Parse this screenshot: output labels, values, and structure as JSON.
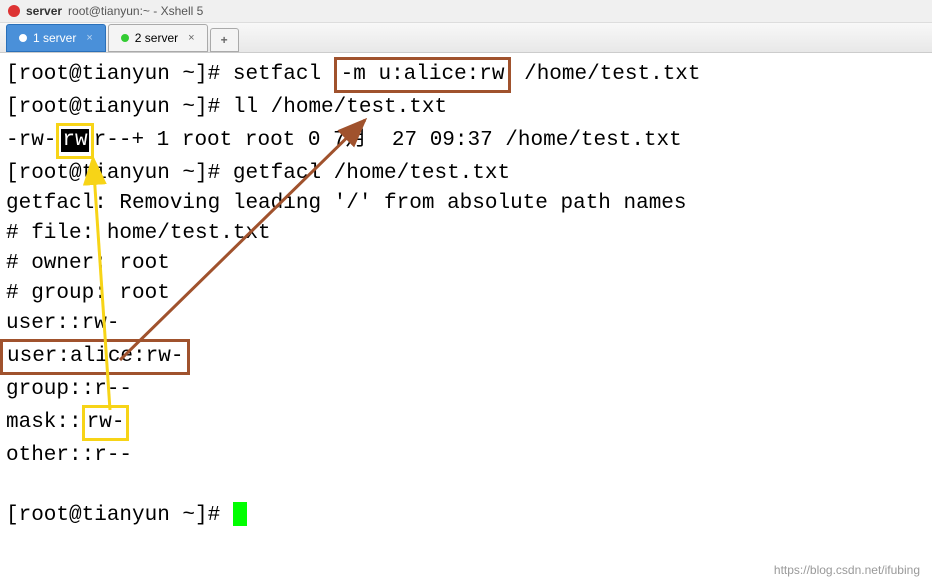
{
  "window": {
    "app_label": "server",
    "title": "root@tianyun:~ - Xshell 5"
  },
  "tabs": {
    "tab1": "1 server",
    "tab2": "2 server",
    "add": "+"
  },
  "terminal": {
    "prompt1_pre": "[root@tianyun ~]# setfacl ",
    "setfacl_box": "-m u:alice:rw",
    "prompt1_post": " /home/test.txt",
    "line2": "[root@tianyun ~]# ll /home/test.txt",
    "line3_pre": "-rw-",
    "line3_hl": "rw",
    "line3_post": "r--+ 1 root root 0 7月  27 09:37 /home/test.txt",
    "line4": "[root@tianyun ~]# getfacl /home/test.txt",
    "line5": "getfacl: Removing leading '/' from absolute path names",
    "line6": "# file: home/test.txt",
    "line7": "# owner: root",
    "line8": "# group: root",
    "line9": "user::rw-",
    "line10_box": "user:alice:rw-",
    "line11": "group::r--",
    "line12_pre": "mask::",
    "line12_box": "rw-",
    "line13": "other::r--",
    "prompt_final": "[root@tianyun ~]# "
  },
  "watermark": "https://blog.csdn.net/ifubing"
}
